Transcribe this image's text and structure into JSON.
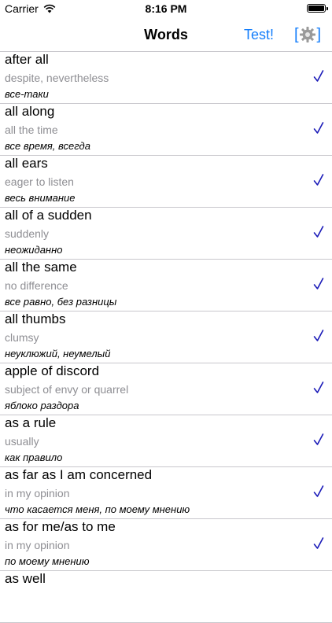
{
  "status_bar": {
    "carrier": "Carrier",
    "time": "8:16 PM"
  },
  "nav": {
    "title": "Words",
    "test_label": "Test!",
    "settings_icon": "gear-icon"
  },
  "accent_color": "#147efb",
  "check_color": "#1a1ab8",
  "words": [
    {
      "phrase": "after all",
      "meaning": "despite, nevertheless",
      "translation": "все-таки",
      "checked": true
    },
    {
      "phrase": "all along",
      "meaning": "all the time",
      "translation": "все время, всегда",
      "checked": true
    },
    {
      "phrase": "all ears",
      "meaning": "eager to listen",
      "translation": "весь внимание",
      "checked": true
    },
    {
      "phrase": "all of a sudden",
      "meaning": "suddenly",
      "translation": "неожиданно",
      "checked": true
    },
    {
      "phrase": "all the same",
      "meaning": "no difference",
      "translation": "все равно, без разницы",
      "checked": true
    },
    {
      "phrase": "all thumbs",
      "meaning": "clumsy",
      "translation": "неуклюжий, неумелый",
      "checked": true
    },
    {
      "phrase": "apple of discord",
      "meaning": "subject of envy or quarrel",
      "translation": "яблоко раздора",
      "checked": true
    },
    {
      "phrase": "as a rule",
      "meaning": "usually",
      "translation": "как правило",
      "checked": true
    },
    {
      "phrase": "as far as I am concerned",
      "meaning": "in my opinion",
      "translation": "что касается меня, по моему мнению",
      "checked": true
    },
    {
      "phrase": "as for me/as to me",
      "meaning": "in my opinion",
      "translation": "по моему мнению",
      "checked": true
    },
    {
      "phrase": "as well",
      "meaning": "",
      "translation": "",
      "checked": false
    }
  ]
}
